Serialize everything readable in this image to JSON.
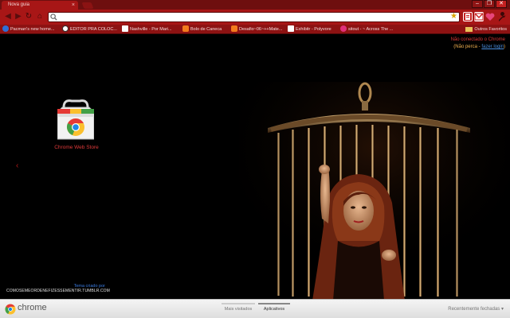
{
  "window": {
    "tab_title": "Nova guia",
    "tab_close": "×",
    "controls": {
      "minimize": "–",
      "restore": "❐",
      "close": "✕"
    }
  },
  "toolbar": {
    "back": "◀",
    "forward": "▶",
    "reload": "↻",
    "home": "⌂",
    "address_value": "",
    "star": "★",
    "wrench": "🔧",
    "extensions": [
      "page-icon",
      "gmail-icon",
      "heart-icon",
      "wrench-icon"
    ]
  },
  "bookmarks": {
    "items": [
      {
        "label": "Pacman's new home...",
        "icon": "blue-circle-icon",
        "color": "#2f6fd6"
      },
      {
        "label": "EDITOR PRA COLOC...",
        "icon": "white-o-icon",
        "color": "#ffffff"
      },
      {
        "label": "Nashville - Por Mari...",
        "icon": "page-icon",
        "color": "#ffffff"
      },
      {
        "label": "Bolo de Caneca",
        "icon": "blogger-icon",
        "color": "#f37b1d"
      },
      {
        "label": "Desafio~06~++Mate...",
        "icon": "blogger-icon",
        "color": "#f37b1d"
      },
      {
        "label": "Exhibitr - Polyvore",
        "icon": "p-icon",
        "color": "#222222"
      },
      {
        "label": "sitout - ~ Across The ...",
        "icon": "pink-circle-icon",
        "color": "#e0307a"
      }
    ],
    "folder": "Outros Favoritos"
  },
  "content": {
    "signin_line1": "Não conectado o Chrome",
    "signin_prefix": "(Não perca - ",
    "signin_link": "fazer login",
    "signin_suffix": ")",
    "webstore_label": "Chrome Web Store",
    "pager_left": "‹",
    "credit_line1": "Tema criado por",
    "credit_line2": "COMOSEMEORDENEFIZESSEMENTIR.TUMBLR.COM"
  },
  "footer": {
    "brand": "chrome",
    "tabs": [
      {
        "label": "Mais visitados",
        "active": false
      },
      {
        "label": "Aplicativos",
        "active": true
      }
    ],
    "recently_closed": "Recentemente fechadas ▾"
  },
  "colors": {
    "frame": "#a81616",
    "tabstrip": "#6e0f0f",
    "bookmark_bar": "#8d1212",
    "accent_red": "#e03a3a",
    "link_blue": "#4a8fe0"
  }
}
